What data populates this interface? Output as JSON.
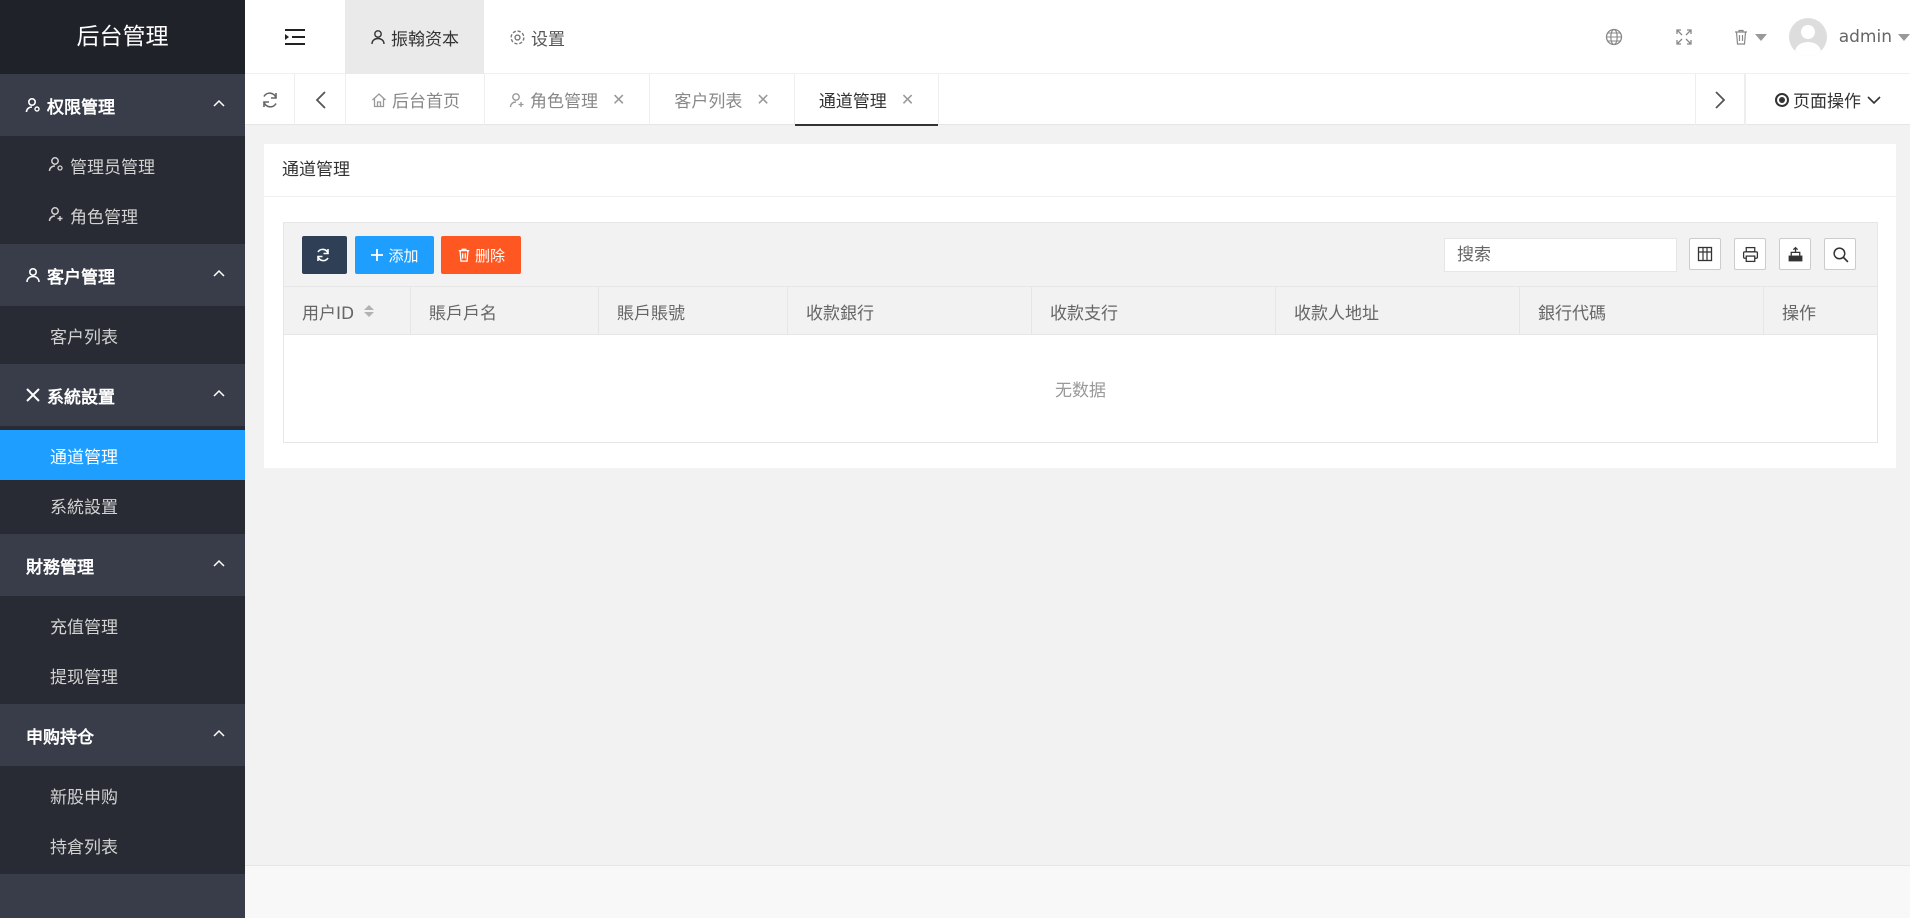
{
  "app": {
    "title": "后台管理"
  },
  "sidebar": {
    "groups": [
      {
        "label": "权限管理",
        "items": [
          "管理员管理",
          "角色管理"
        ]
      },
      {
        "label": "客户管理",
        "items": [
          "客户列表"
        ]
      },
      {
        "label": "系統設置",
        "items": [
          "通道管理",
          "系統設置"
        ]
      },
      {
        "label": "財務管理",
        "items": [
          "充值管理",
          "提现管理"
        ]
      },
      {
        "label": "申购持仓",
        "items": [
          "新股申购",
          "持倉列表"
        ]
      }
    ],
    "active_item": "通道管理"
  },
  "header": {
    "nav": [
      "振翰资本",
      "设置"
    ],
    "user": "admin"
  },
  "tabs": {
    "items": [
      "后台首页",
      "角色管理",
      "客户列表",
      "通道管理"
    ],
    "active": "通道管理",
    "page_ops": "页面操作"
  },
  "card": {
    "title": "通道管理",
    "toolbar": {
      "add": "添加",
      "delete": "删除",
      "search_placeholder": "搜索"
    },
    "columns": [
      "用户ID",
      "賬戶戶名",
      "賬戶賬號",
      "收款銀行",
      "收款支行",
      "收款人地址",
      "銀行代碼",
      "操作"
    ],
    "empty_text": "无数据"
  },
  "colors": {
    "sidebar": "#393D49",
    "sidebar_sub": "#282B33",
    "active": "#1E9FFF",
    "danger": "#FF5722",
    "dark_btn": "#2F4056"
  }
}
